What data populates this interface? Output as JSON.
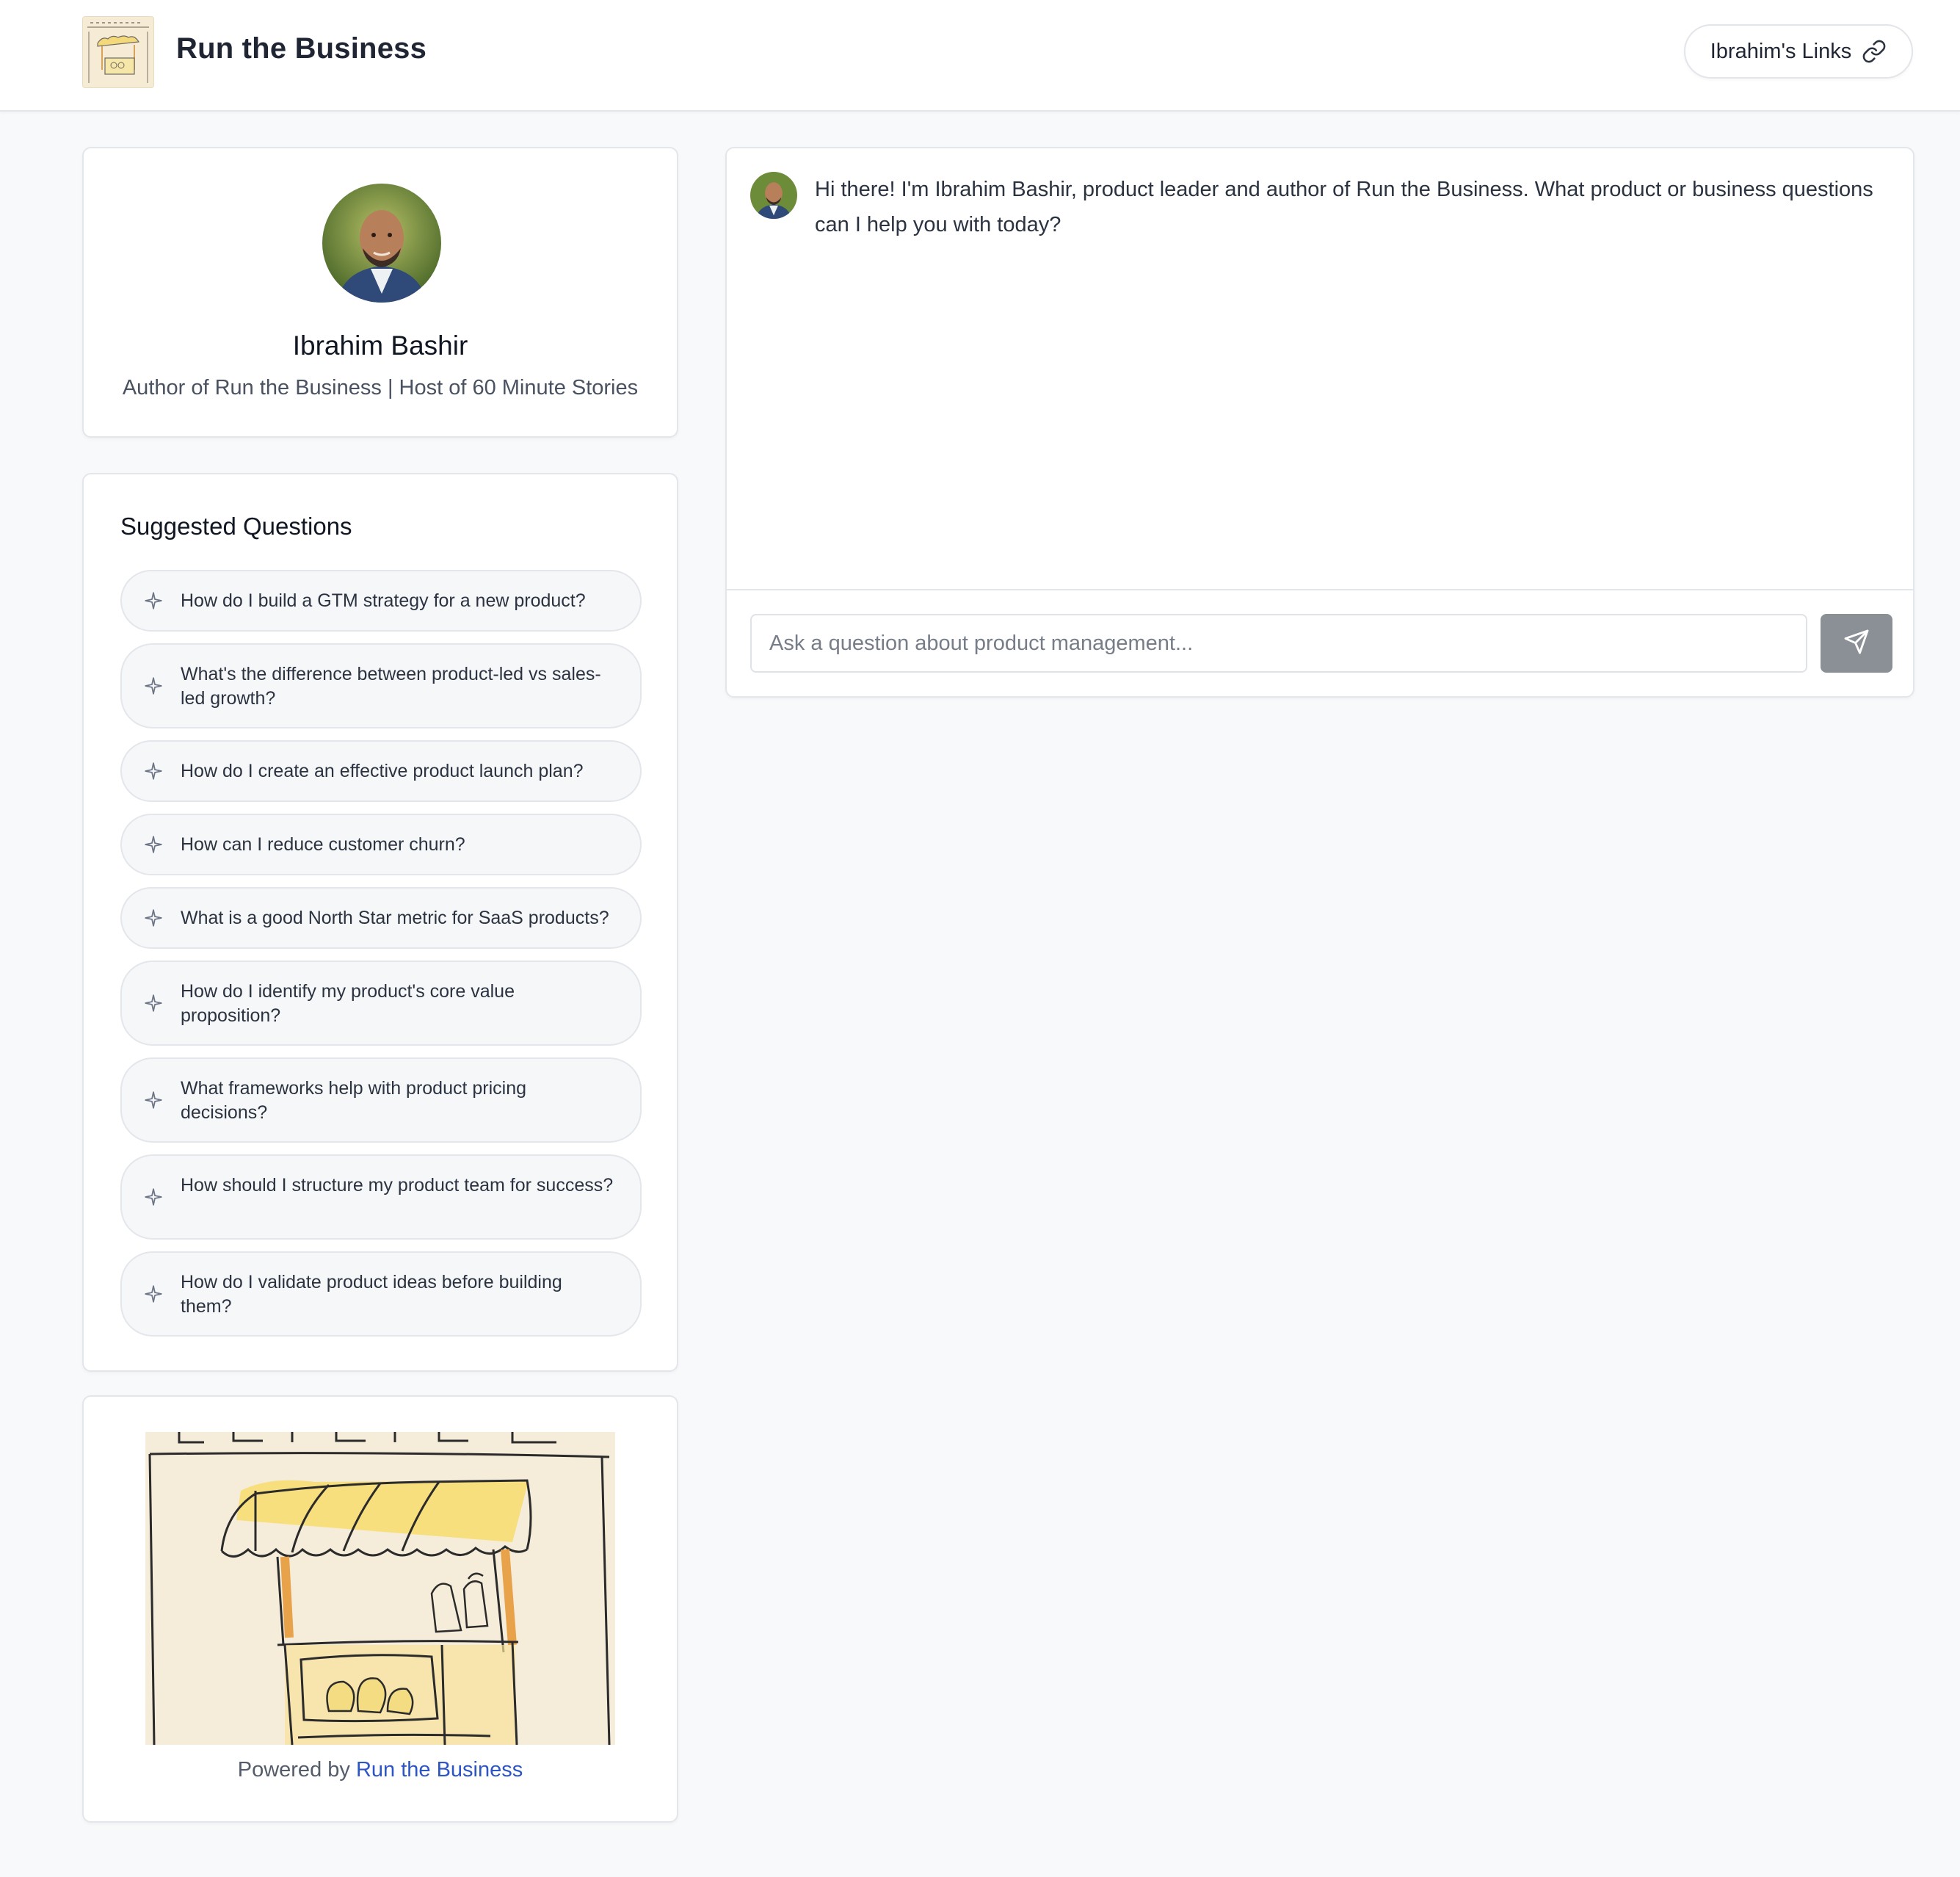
{
  "header": {
    "title": "Run the Business",
    "links_button": "Ibrahim's Links"
  },
  "profile": {
    "name": "Ibrahim Bashir",
    "subtitle": "Author of Run the Business | Host of 60 Minute Stories"
  },
  "suggestions": {
    "title": "Suggested Questions",
    "items": [
      "How do I build a GTM strategy for a new product?",
      "What's the difference between product-led vs sales-led growth?",
      "How do I create an effective product launch plan?",
      "How can I reduce customer churn?",
      "What is a good North Star metric for SaaS products?",
      "How do I identify my product's core value proposition?",
      "What frameworks help with product pricing decisions?",
      "How should I structure my product team for success?",
      "How do I validate product ideas before building them?"
    ]
  },
  "footer_card": {
    "powered_prefix": "Powered by ",
    "powered_link": "Run the Business"
  },
  "chat": {
    "greeting": "Hi there! I'm Ibrahim Bashir, product leader and author of Run the Business. What product or business questions can I help you with today?",
    "input_placeholder": "Ask a question about product management..."
  },
  "icons": {
    "links": "link-icon",
    "suggestion": "sparkle-icon",
    "send": "send-icon"
  },
  "colors": {
    "page_bg": "#f8f9fb",
    "link": "#2d55c3",
    "send_button": "#8b8f96"
  }
}
